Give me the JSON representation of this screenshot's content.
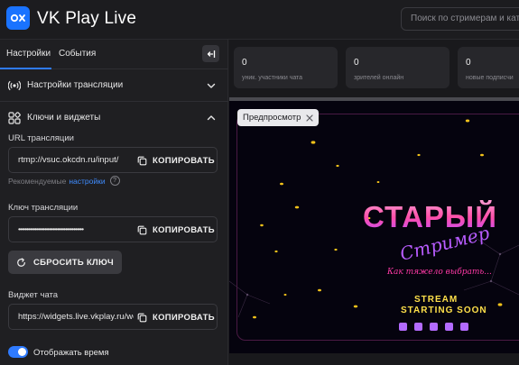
{
  "header": {
    "logo_text": "VK Play Live",
    "search_placeholder": "Поиск по стримерам и катего"
  },
  "sidebar": {
    "tabs": [
      {
        "label": "Настройки",
        "active": true
      },
      {
        "label": "События",
        "active": false
      }
    ],
    "sections": {
      "broadcast_settings": "Настройки трансляции",
      "keys_widgets": "Ключи и виджеты"
    },
    "url": {
      "label": "URL трансляции",
      "value": "rtmp://vsuc.okcdn.ru/input/",
      "copy_label": "КОПИРОВАТЬ"
    },
    "recommended": {
      "text": "Рекомендуемые",
      "link": "настройки",
      "help": "?"
    },
    "stream_key": {
      "label": "Ключ трансляции",
      "value": "••••••••••••••••••••••••••••••••••••••••",
      "copy_label": "КОПИРОВАТЬ"
    },
    "reset_label": "СБРОСИТЬ КЛЮЧ",
    "chat_widget": {
      "label": "Виджет чата",
      "value": "https://widgets.live.vkplay.ru/wet",
      "copy_label": "КОПИРОВАТЬ"
    },
    "show_time": {
      "label": "Отображать время",
      "enabled": true
    }
  },
  "stats": [
    {
      "value": "0",
      "caption": "уник. участники чата"
    },
    {
      "value": "0",
      "caption": "зрителей онлайн"
    },
    {
      "value": "0",
      "caption": "новые подписчи"
    }
  ],
  "preview": {
    "chip_label": "Предпросмотр",
    "title": "СТАРЫЙ",
    "script": "Стример",
    "tagline": "Как тяжело выбрать...",
    "stream_line1": "STREAM",
    "stream_line2": "STARTING SOON"
  },
  "colors": {
    "accent": "#2f7bff",
    "brand": "#1a73ff",
    "link": "#3f8cff",
    "preview_pink": "#ff4fa8",
    "preview_yellow": "#ffe04a"
  }
}
